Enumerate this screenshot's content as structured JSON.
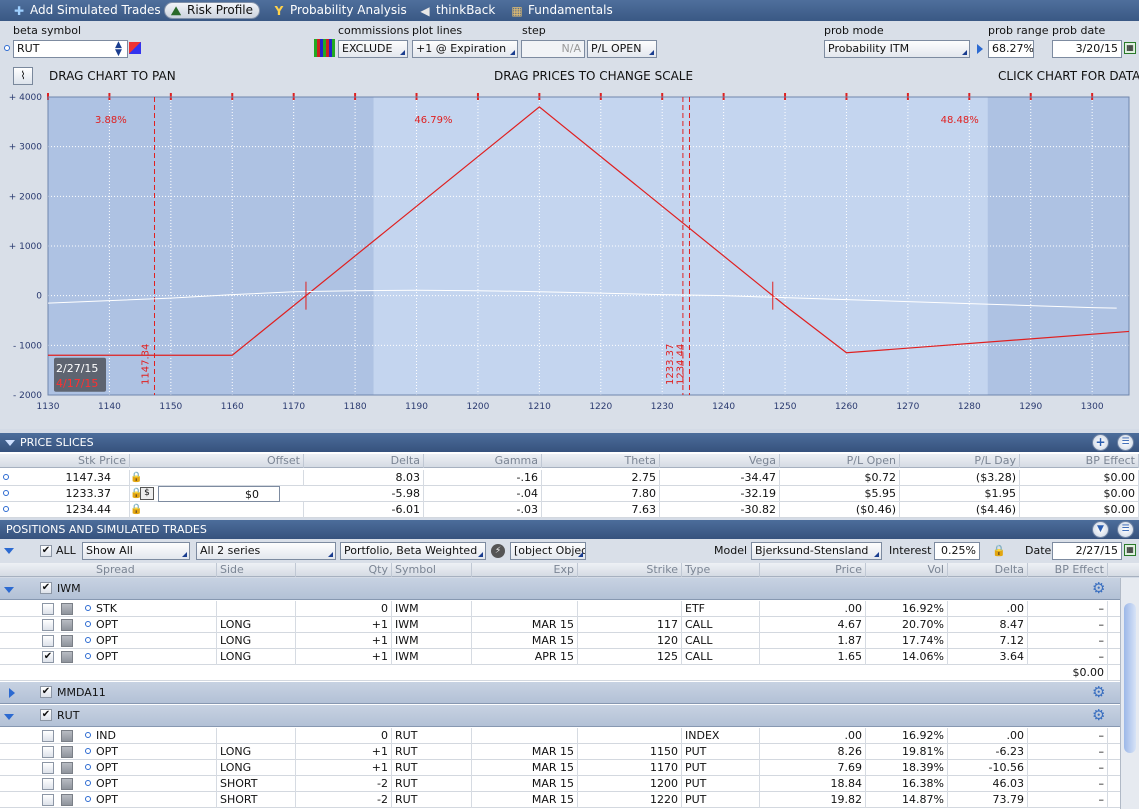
{
  "tabs": [
    {
      "label": "Add Simulated Trades",
      "icon": "plus-icon",
      "active": false
    },
    {
      "label": "Risk Profile",
      "icon": "risk-profile-icon",
      "active": true
    },
    {
      "label": "Probability Analysis",
      "icon": "probability-icon",
      "active": false
    },
    {
      "label": "thinkBack",
      "icon": "thinkback-icon",
      "active": false
    },
    {
      "label": "Fundamentals",
      "icon": "fundamentals-icon",
      "active": false
    }
  ],
  "toolbar": {
    "beta_symbol_label": "beta symbol",
    "beta_symbol": "RUT",
    "commissions_label": "commissions",
    "commissions": "EXCLUDE",
    "plot_lines_label": "plot lines",
    "plot_lines": "+1 @ Expiration",
    "step_label": "step",
    "step": "N/A",
    "pl_mode": "P/L OPEN",
    "prob_mode_label": "prob mode",
    "prob_mode": "Probability ITM",
    "prob_range_label": "prob range",
    "prob_range": "68.27%",
    "prob_date_label": "prob date",
    "prob_date": "3/20/15"
  },
  "chart_bar": {
    "left": "DRAG CHART TO PAN",
    "center": "DRAG PRICES TO CHANGE SCALE",
    "right": "CLICK CHART FOR DATA"
  },
  "chart_data": {
    "type": "line",
    "xlim": [
      1130,
      1306
    ],
    "ylim": [
      -2000,
      4000
    ],
    "x_ticks": [
      1130,
      1140,
      1150,
      1160,
      1170,
      1180,
      1190,
      1200,
      1210,
      1220,
      1230,
      1240,
      1250,
      1260,
      1270,
      1280,
      1290,
      1300
    ],
    "y_ticks": [
      "+ 4000",
      "+ 3000",
      "+ 2000",
      "+ 1000",
      "0",
      "- 1000",
      "- 2000"
    ],
    "y_tick_values": [
      4000,
      3000,
      2000,
      1000,
      0,
      -1000,
      -2000
    ],
    "prob_labels": [
      "3.88%",
      "46.79%",
      "48.48%"
    ],
    "series": [
      {
        "color": "#e02020",
        "x": [
          1130,
          1150,
          1160,
          1210,
          1250,
          1260,
          1306
        ],
        "y": [
          -1200,
          -1200,
          -1200,
          3800,
          -200,
          -1150,
          -720
        ]
      },
      {
        "color": "#ffffff",
        "x": [
          1130,
          1150,
          1160,
          1170,
          1180,
          1190,
          1200,
          1210,
          1220,
          1230,
          1240,
          1250,
          1260,
          1270,
          1280,
          1290,
          1300,
          1304
        ],
        "y": [
          -150,
          -50,
          20,
          80,
          100,
          110,
          100,
          80,
          50,
          20,
          0,
          -40,
          -80,
          -120,
          -160,
          -200,
          -240,
          -250
        ]
      }
    ],
    "price_markers": [
      {
        "price": 1147.34,
        "label": "1147.34"
      },
      {
        "price": 1233.37,
        "label": "1233.37"
      },
      {
        "price": 1234.44,
        "label": "1234.44"
      }
    ],
    "breakevens": [
      1172,
      1248
    ],
    "date_labels": [
      "2/27/15",
      "4/17/15"
    ]
  },
  "price_slices": {
    "title": "PRICE SLICES",
    "columns": [
      "Stk Price",
      "Offset",
      "Delta",
      "Gamma",
      "Theta",
      "Vega",
      "P/L Open",
      "P/L Day",
      "BP Effect"
    ],
    "rows": [
      {
        "price": "1147.34",
        "offset": "",
        "delta": "8.03",
        "gamma": "-.16",
        "theta": "2.75",
        "vega": "-34.47",
        "pl_open": "$0.72",
        "pl_day": "($3.28)",
        "bp": "$0.00"
      },
      {
        "price": "1233.37",
        "offset": "$0",
        "delta": "-5.98",
        "gamma": "-.04",
        "theta": "7.80",
        "vega": "-32.19",
        "pl_open": "$5.95",
        "pl_day": "$1.95",
        "bp": "$0.00"
      },
      {
        "price": "1234.44",
        "offset": "",
        "delta": "-6.01",
        "gamma": "-.03",
        "theta": "7.63",
        "vega": "-30.82",
        "pl_open": "($0.46)",
        "pl_day": "($4.46)",
        "bp": "$0.00"
      }
    ]
  },
  "positions": {
    "title": "POSITIONS AND SIMULATED TRADES",
    "all_label": "ALL",
    "show": "Show All",
    "series": "All 2 series",
    "portfolio": "Portfolio, Beta Weighted",
    "groups": [
      {
        "name": "IWM",
        "rows": [
          {
            "spread": "STK",
            "side": "",
            "qty": "0",
            "symbol": "IWM",
            "exp": "",
            "strike": "",
            "type": "ETF",
            "price": ".00",
            "vol": "16.92%",
            "delta": ".00",
            "bp": "–",
            "checked": false
          },
          {
            "spread": "OPT",
            "side": "LONG",
            "qty": "+1",
            "symbol": "IWM",
            "exp": "MAR 15",
            "strike": "117",
            "type": "CALL",
            "price": "4.67",
            "vol": "20.70%",
            "delta": "8.47",
            "bp": "–",
            "checked": false
          },
          {
            "spread": "OPT",
            "side": "LONG",
            "qty": "+1",
            "symbol": "IWM",
            "exp": "MAR 15",
            "strike": "120",
            "type": "CALL",
            "price": "1.87",
            "vol": "17.74%",
            "delta": "7.12",
            "bp": "–",
            "checked": false
          },
          {
            "spread": "OPT",
            "side": "LONG",
            "qty": "+1",
            "symbol": "IWM",
            "exp": "APR 15",
            "strike": "125",
            "type": "CALL",
            "price": "1.65",
            "vol": "14.06%",
            "delta": "3.64",
            "bp": "–",
            "checked": true
          }
        ],
        "total": "$0.00"
      },
      {
        "name": "MMDA11"
      },
      {
        "name": "RUT",
        "rows": [
          {
            "spread": "IND",
            "side": "",
            "qty": "0",
            "symbol": "RUT",
            "exp": "",
            "strike": "",
            "type": "INDEX",
            "price": ".00",
            "vol": "16.92%",
            "delta": ".00",
            "bp": "–",
            "checked": false
          },
          {
            "spread": "OPT",
            "side": "LONG",
            "qty": "+1",
            "symbol": "RUT",
            "exp": "MAR 15",
            "strike": "1150",
            "type": "PUT",
            "price": "8.26",
            "vol": "19.81%",
            "delta": "-6.23",
            "bp": "–",
            "checked": false
          },
          {
            "spread": "OPT",
            "side": "LONG",
            "qty": "+1",
            "symbol": "RUT",
            "exp": "MAR 15",
            "strike": "1170",
            "type": "PUT",
            "price": "7.69",
            "vol": "18.39%",
            "delta": "-10.56",
            "bp": "–",
            "checked": false
          },
          {
            "spread": "OPT",
            "side": "SHORT",
            "qty": "-2",
            "symbol": "RUT",
            "exp": "MAR 15",
            "strike": "1200",
            "type": "PUT",
            "price": "18.84",
            "vol": "16.38%",
            "delta": "46.03",
            "bp": "–",
            "checked": false
          },
          {
            "spread": "OPT",
            "side": "SHORT",
            "qty": "-2",
            "symbol": "RUT",
            "exp": "MAR 15",
            "strike": "1220",
            "type": "PUT",
            "price": "19.82",
            "vol": "14.87%",
            "delta": "73.79",
            "bp": "–",
            "checked": false
          }
        ]
      }
    ],
    "model_label": "Model",
    "model": "Bjerksund-Stensland",
    "interest_label": "Interest",
    "interest": "0.25%",
    "date_label": "Date",
    "date": "2/27/15",
    "columns": [
      "Spread",
      "Side",
      "Qty",
      "Symbol",
      "Exp",
      "Strike",
      "Type",
      "Price",
      "Vol",
      "Delta",
      "BP Effect"
    ]
  }
}
